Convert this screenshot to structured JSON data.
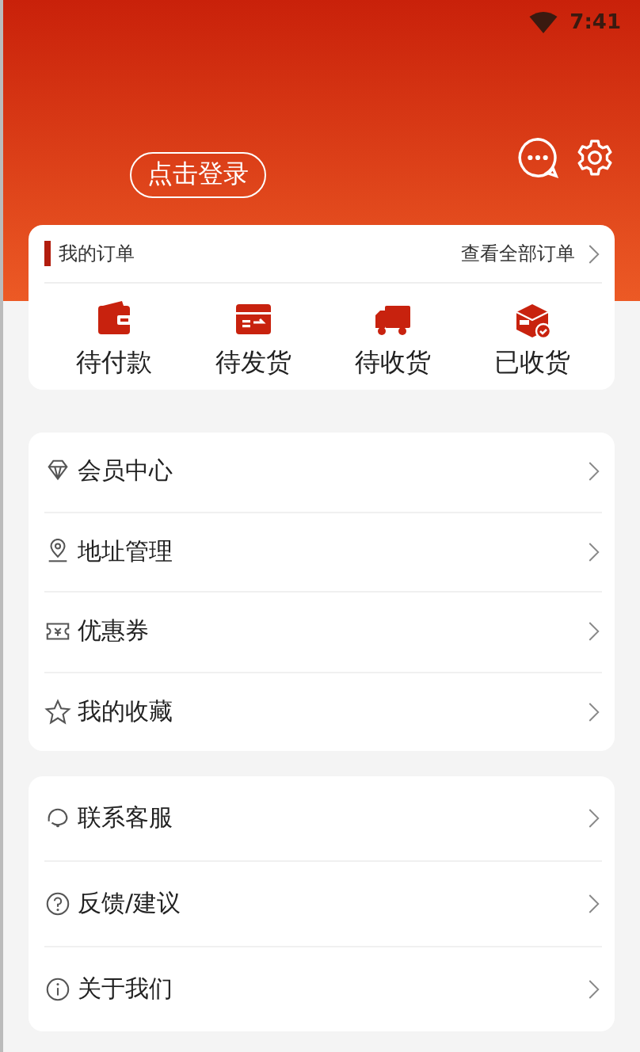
{
  "status_bar": {
    "time": "7:41"
  },
  "header": {
    "login_button": "点击登录"
  },
  "orders": {
    "title": "我的订单",
    "view_all": "查看全部订单",
    "items": [
      {
        "label": "待付款"
      },
      {
        "label": "待发货"
      },
      {
        "label": "待收货"
      },
      {
        "label": "已收货"
      }
    ]
  },
  "menu_groups": [
    {
      "items": [
        {
          "label": "会员中心"
        },
        {
          "label": "地址管理"
        },
        {
          "label": "优惠券"
        },
        {
          "label": "我的收藏"
        }
      ]
    },
    {
      "items": [
        {
          "label": "联系客服"
        },
        {
          "label": "反馈/建议"
        },
        {
          "label": "关于我们"
        }
      ]
    }
  ]
}
